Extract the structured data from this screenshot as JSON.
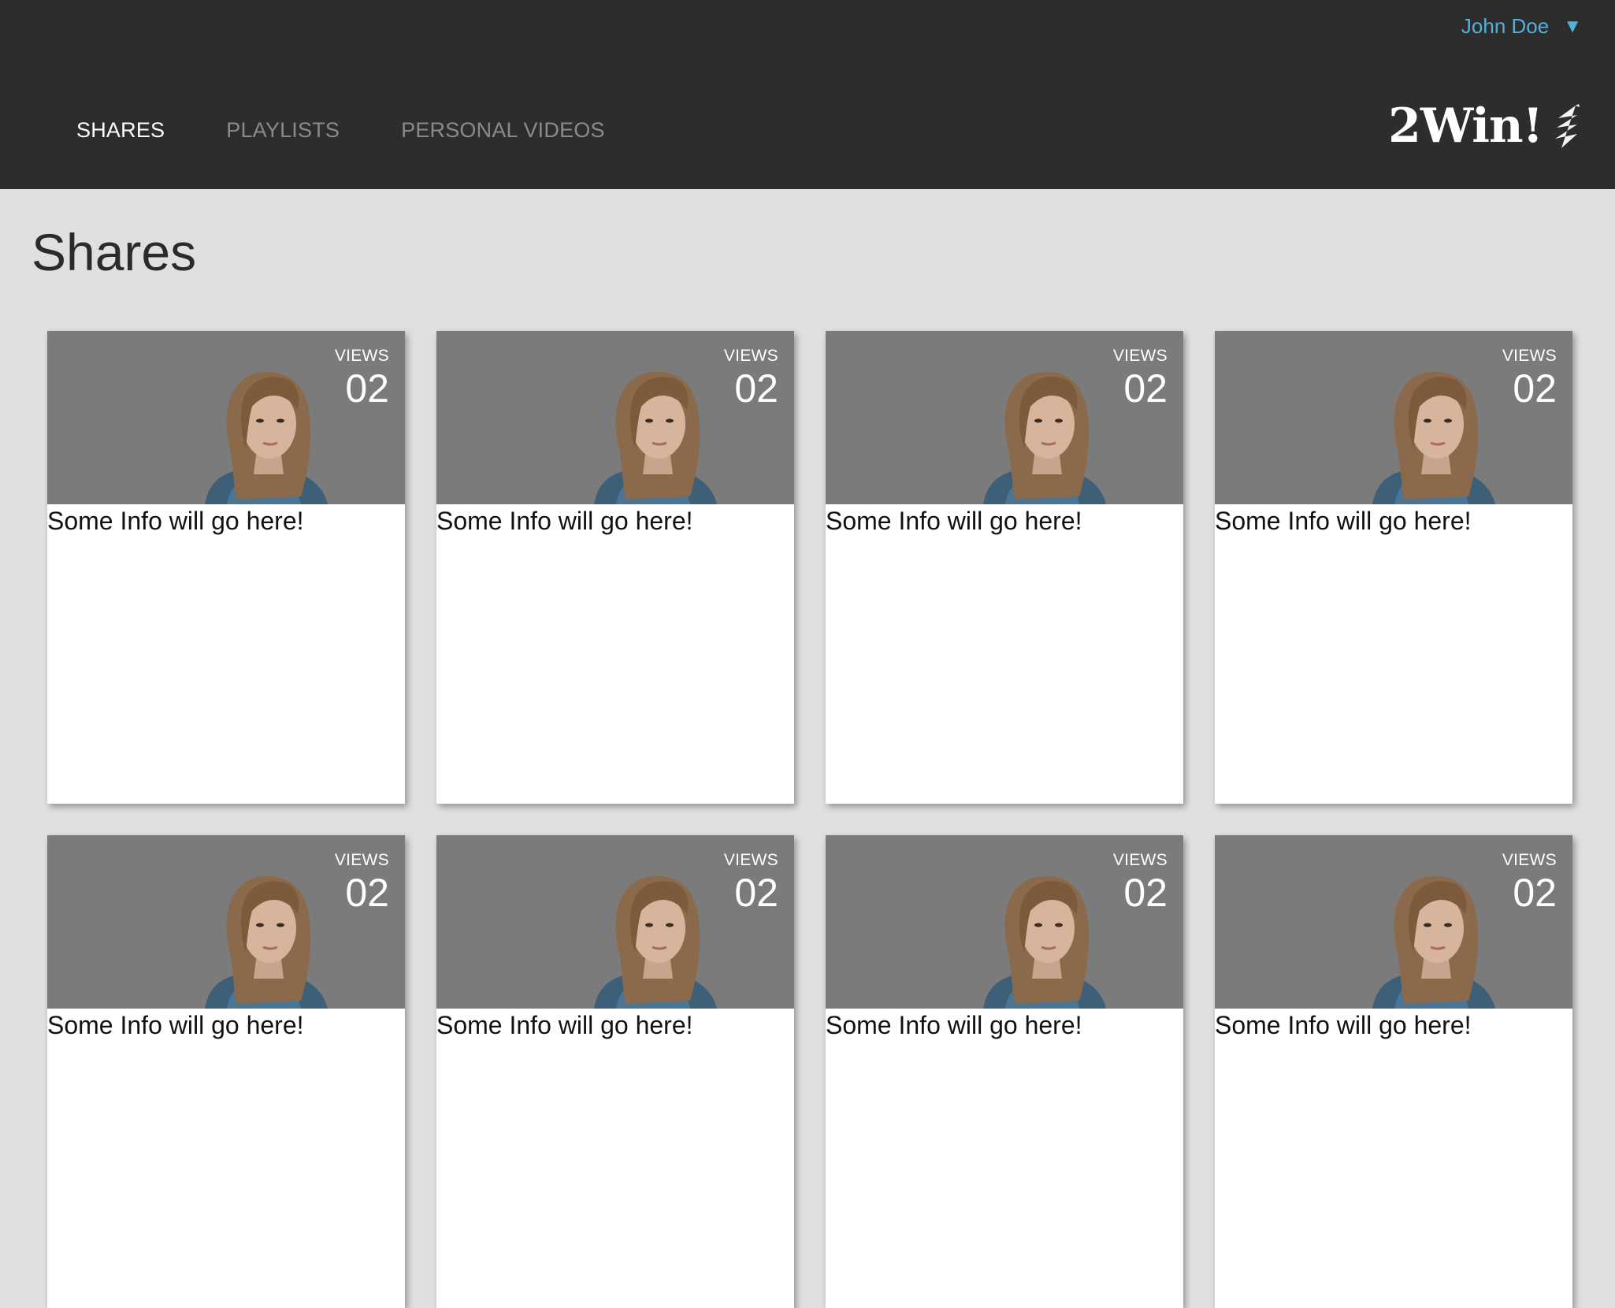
{
  "header": {
    "user_name": "John Doe",
    "user_caret_icon": "caret-down-icon",
    "tabs": [
      {
        "label": "SHARES",
        "active": true
      },
      {
        "label": "PLAYLISTS",
        "active": false
      },
      {
        "label": "PERSONAL VIDEOS",
        "active": false
      }
    ],
    "logo_text": "2Win!",
    "colors": {
      "bar": "#2d2d2d",
      "user_accent": "#4eb3d8"
    }
  },
  "main": {
    "title": "Shares",
    "cards": [
      {
        "views_label": "VIEWS",
        "views_count": "02",
        "info": "Some Info will go here!"
      },
      {
        "views_label": "VIEWS",
        "views_count": "02",
        "info": "Some Info will go here!"
      },
      {
        "views_label": "VIEWS",
        "views_count": "02",
        "info": "Some Info will go here!"
      },
      {
        "views_label": "VIEWS",
        "views_count": "02",
        "info": "Some Info will go here!"
      },
      {
        "views_label": "VIEWS",
        "views_count": "02",
        "info": "Some Info will go here!"
      },
      {
        "views_label": "VIEWS",
        "views_count": "02",
        "info": "Some Info will go here!"
      },
      {
        "views_label": "VIEWS",
        "views_count": "02",
        "info": "Some Info will go here!"
      },
      {
        "views_label": "VIEWS",
        "views_count": "02",
        "info": "Some Info will go here!"
      }
    ]
  }
}
